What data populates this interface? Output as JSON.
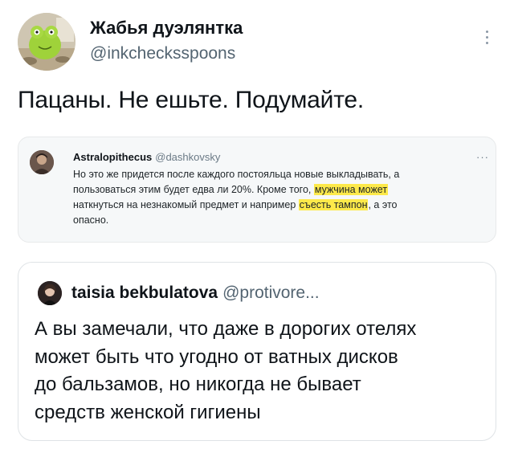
{
  "author": {
    "name": "Жабья дуэлянтка",
    "handle": "@inkchecksspoons"
  },
  "tweet": {
    "text": "Пацаны. Не ешьте. Подумайте."
  },
  "embedded_image": {
    "name": "Astralopithecus",
    "handle": "@dashkovsky",
    "menu": "···",
    "line1": "Но это же придется после каждого постояльца новые выкладывать, а",
    "line2a": "пользоваться этим будет едва ли 20%. Кроме того, ",
    "line2b": "мужчина может",
    "line3a": "наткнуться на незнакомый предмет и например ",
    "line3b": "съесть тампон",
    "line3c": ", а это",
    "line4": "опасно.",
    "highlight_color": "#fde94a"
  },
  "quoted_tweet": {
    "name": "taisia bekbulatova",
    "handle": "@protivore...",
    "lines": [
      "А вы замечали, что даже в дорогих отелях",
      "может быть что угодно от ватных дисков",
      "до бальзамов, но никогда не бывает",
      "средств женской гигиены"
    ]
  }
}
